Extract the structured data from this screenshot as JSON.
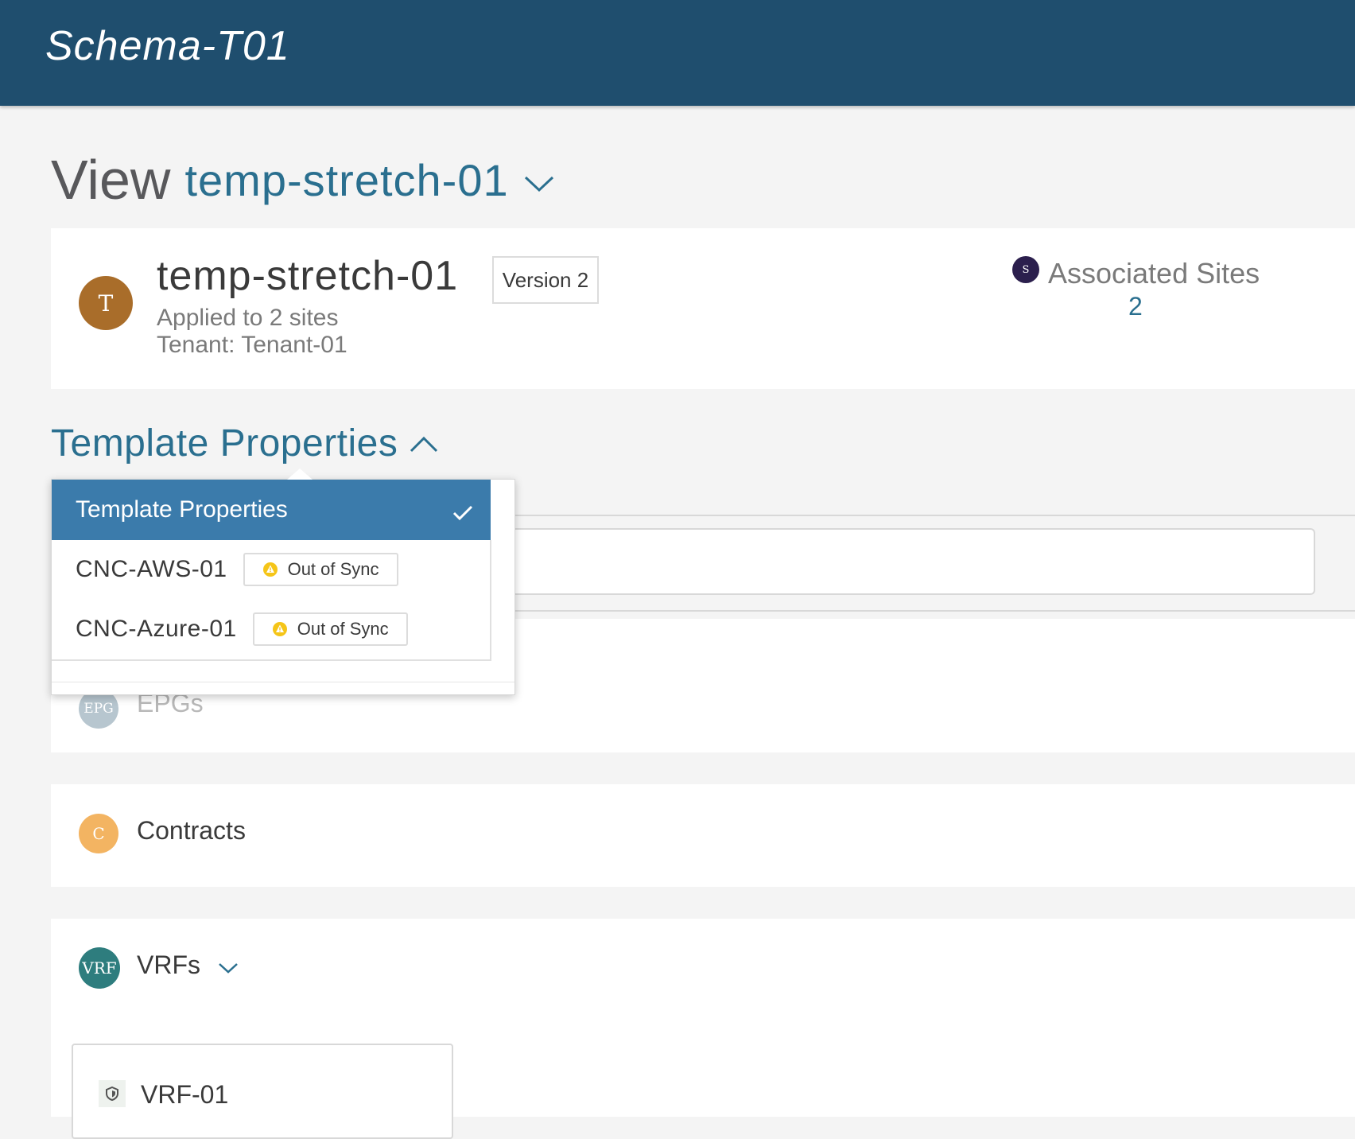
{
  "header": {
    "title": "Schema-T01"
  },
  "view": {
    "prefix": "View",
    "template_name": "temp-stretch-01"
  },
  "summary": {
    "avatar_letter": "T",
    "template_name": "temp-stretch-01",
    "version": "Version 2",
    "applied_text": "Applied to 2 sites",
    "tenant_text": "Tenant: Tenant-01",
    "associated_sites": {
      "icon_letter": "S",
      "label": "Associated Sites",
      "count": "2"
    }
  },
  "template_properties": {
    "title": "Template Properties",
    "dropdown": {
      "selected_label": "Template Properties",
      "items": [
        {
          "label": "CNC-AWS-01",
          "status": "Out of Sync"
        },
        {
          "label": "CNC-Azure-01",
          "status": "Out of Sync"
        }
      ]
    }
  },
  "sections": {
    "epgs": {
      "avatar": "EPG",
      "label": "EPGs"
    },
    "contracts": {
      "avatar": "C",
      "label": "Contracts"
    },
    "vrfs": {
      "avatar": "VRF",
      "label": "VRFs",
      "items": [
        {
          "name": "VRF-01"
        }
      ]
    }
  },
  "colors": {
    "header_bg": "#1f4e6e",
    "accent": "#2a6f8f",
    "selected_bg": "#3b7bab",
    "warning": "#f5c518"
  }
}
